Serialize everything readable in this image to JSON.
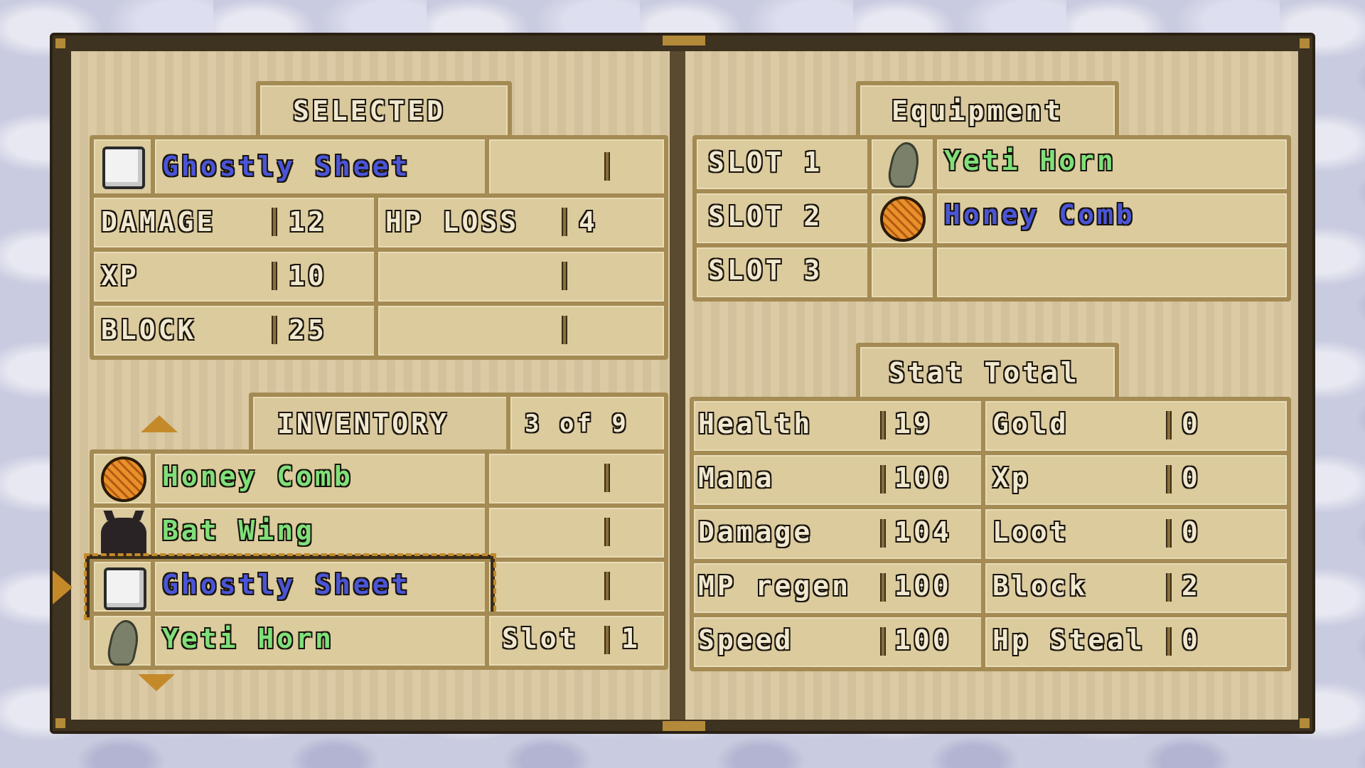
{
  "selected": {
    "header": "SELECTED",
    "item_name": "Ghostly Sheet",
    "item_icon": "ghostly-sheet-icon",
    "stats": [
      {
        "label": "DAMAGE",
        "value": "12"
      },
      {
        "label": "XP",
        "value": "10"
      },
      {
        "label": "BLOCK",
        "value": "25"
      }
    ],
    "extra_stats": [
      {
        "label": "HP LOSS",
        "value": "4"
      },
      {
        "label": "",
        "value": ""
      },
      {
        "label": "",
        "value": ""
      }
    ]
  },
  "inventory": {
    "header": "INVENTORY",
    "count": "3 of 9",
    "items": [
      {
        "name": "Honey Comb",
        "icon": "honey-comb-icon",
        "slot_label": "",
        "slot_value": ""
      },
      {
        "name": "Bat Wing",
        "icon": "bat-wing-icon",
        "slot_label": "",
        "slot_value": ""
      },
      {
        "name": "Ghostly Sheet",
        "icon": "ghostly-sheet-icon",
        "slot_label": "",
        "slot_value": ""
      },
      {
        "name": "Yeti Horn",
        "icon": "yeti-horn-icon",
        "slot_label": "Slot",
        "slot_value": "1"
      }
    ]
  },
  "equipment": {
    "header": "Equipment",
    "slots": [
      {
        "label": "SLOT 1",
        "item": "Yeti Horn",
        "icon": "yeti-horn-icon"
      },
      {
        "label": "SLOT 2",
        "item": "Honey Comb",
        "icon": "honey-comb-icon"
      },
      {
        "label": "SLOT 3",
        "item": "",
        "icon": ""
      }
    ]
  },
  "stat_total": {
    "header": "Stat Total",
    "left": [
      {
        "label": "Health",
        "value": "19"
      },
      {
        "label": "Mana",
        "value": "100"
      },
      {
        "label": "Damage",
        "value": "104"
      },
      {
        "label": "MP regen",
        "value": "100"
      },
      {
        "label": "Speed",
        "value": "100"
      }
    ],
    "right": [
      {
        "label": "Gold",
        "value": "0"
      },
      {
        "label": "Xp",
        "value": "0"
      },
      {
        "label": "Loot",
        "value": "0"
      },
      {
        "label": "Block",
        "value": "2"
      },
      {
        "label": "Hp Steal",
        "value": "0"
      }
    ]
  },
  "colors": {
    "page": "#d9c79f",
    "cell_border": "#a48a53",
    "text_cream": "#f0e8cf",
    "text_green": "#7fe07a",
    "text_blue": "#4a55d8",
    "accent_gold": "#c48a2a"
  }
}
